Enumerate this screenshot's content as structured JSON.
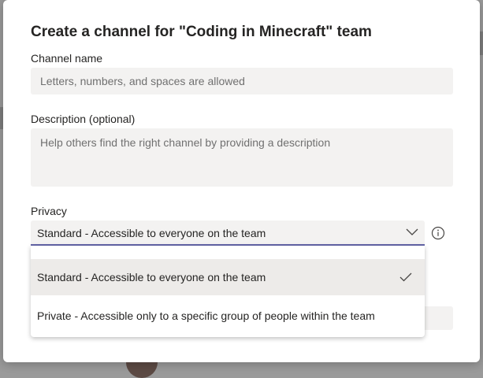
{
  "dialog": {
    "title": "Create a channel for \"Coding in Minecraft\" team",
    "channel_name": {
      "label": "Channel name",
      "placeholder": "Letters, numbers, and spaces are allowed",
      "value": ""
    },
    "description": {
      "label": "Description (optional)",
      "placeholder": "Help others find the right channel by providing a description",
      "value": ""
    },
    "privacy": {
      "label": "Privacy",
      "selected": "Standard - Accessible to everyone on the team",
      "options": [
        {
          "label": "Standard - Accessible to everyone on the team",
          "selected": true
        },
        {
          "label": "Private - Accessible only to a specific group of people within the team",
          "selected": false
        }
      ]
    },
    "icons": {
      "dropdown": "chevron-down-icon",
      "info": "info-icon",
      "selected_mark": "checkmark-icon"
    },
    "colors": {
      "accent": "#6264a7",
      "field_background": "#f3f2f1",
      "selected_item_background": "#edebe9",
      "overlay": "#9a9a9a"
    }
  }
}
